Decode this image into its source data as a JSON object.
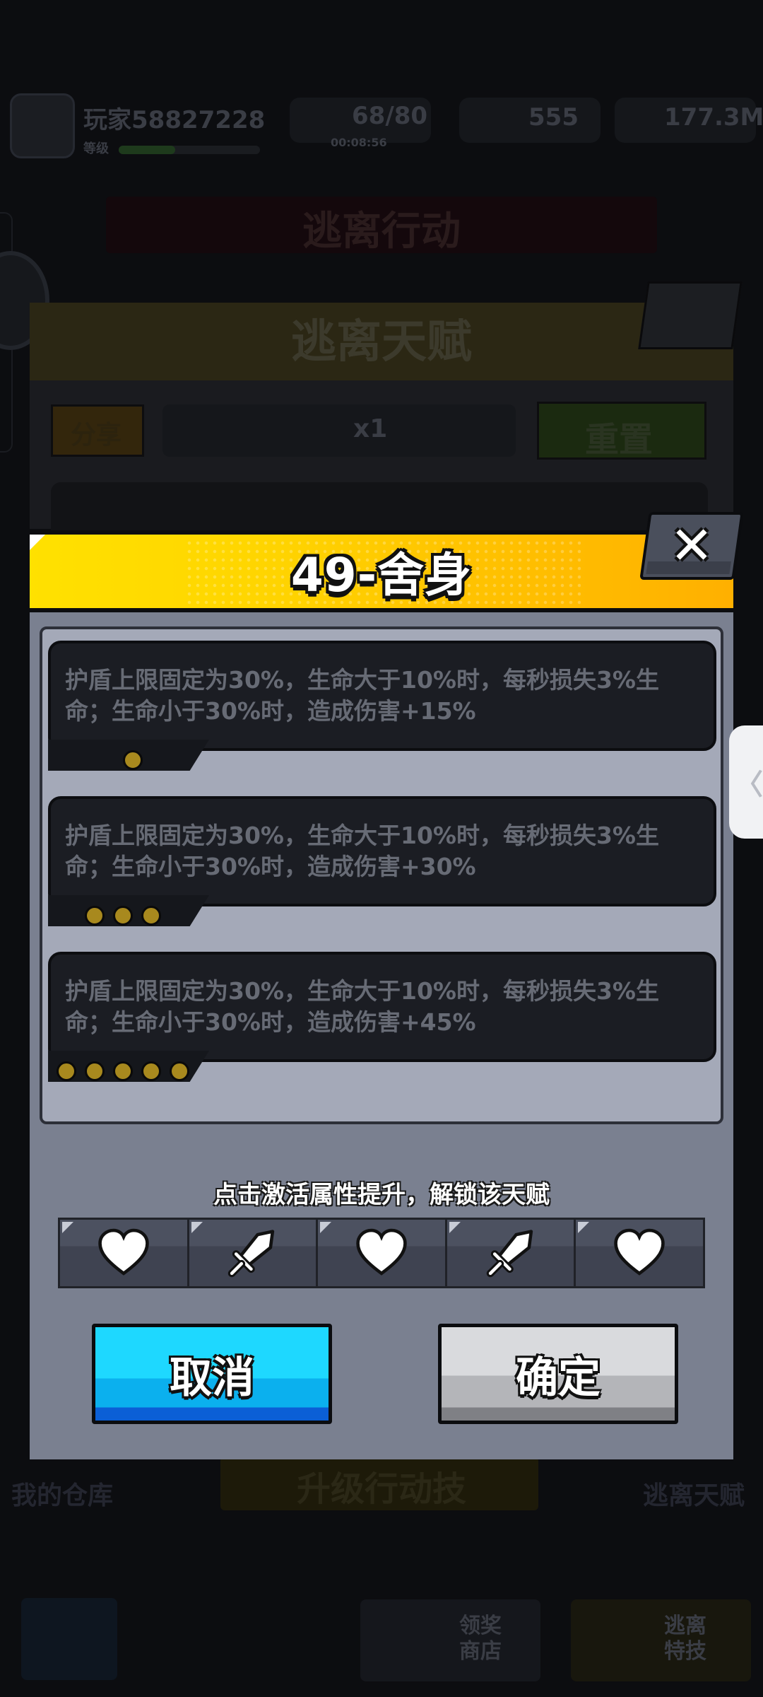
{
  "background": {
    "player_name": "玩家58827228",
    "player_level": "等级",
    "stamina": "68/80",
    "stamina_timer": "00:08:56",
    "gems": "555",
    "coins": "177.3M",
    "mode_title": "逃离行动",
    "panel_title": "逃离天赋",
    "share_label": "分享",
    "item_count": "x1",
    "reset_label": "重置",
    "warehouse_label": "我的仓库",
    "upgrade_label": "升级行动技",
    "talent_label": "逃离天赋",
    "shop_label": "领奖\n商店",
    "skills_label": "逃离\n特技"
  },
  "modal": {
    "title": "49-舍身",
    "tiers": [
      {
        "text": "护盾上限固定为30%，生命大于10%时，每秒损失3%生命；生命小于30%时，造成伤害+15%",
        "dots": 1
      },
      {
        "text": "护盾上限固定为30%，生命大于10%时，每秒损失3%生命；生命小于30%时，造成伤害+30%",
        "dots": 3
      },
      {
        "text": "护盾上限固定为30%，生命大于10%时，每秒损失3%生命；生命小于30%时，造成伤害+45%",
        "dots": 5
      }
    ],
    "hint": "点击激活属性提升，解锁该天赋",
    "attributes": [
      "heart-icon",
      "sword-icon",
      "heart-icon",
      "sword-icon",
      "heart-icon"
    ],
    "cancel_label": "取消",
    "confirm_label": "确定",
    "close_glyph": "✕"
  },
  "side_tab_glyph": "〈",
  "colors": {
    "header_yellow": "#ffd400",
    "cancel_blue": "#1ed8ff",
    "confirm_gray": "#d9dadd",
    "dot_gold": "#a8891e"
  }
}
